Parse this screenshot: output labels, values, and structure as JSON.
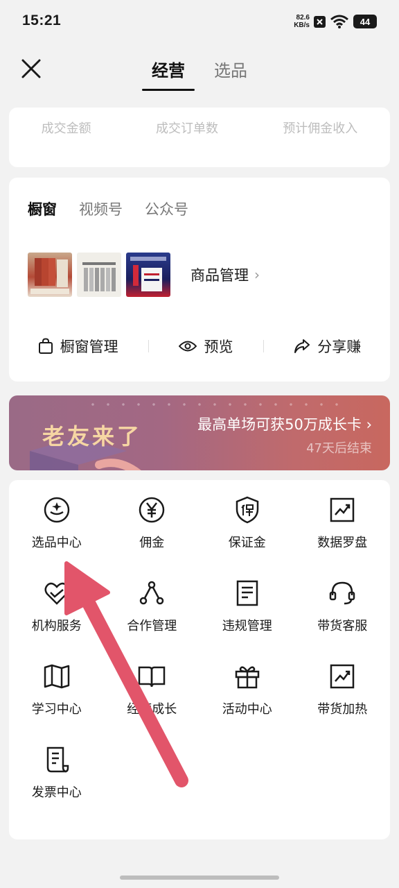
{
  "status": {
    "time": "15:21",
    "speed_value": "82.6",
    "speed_unit": "KB/s",
    "battery": "44"
  },
  "header": {
    "tabs": [
      "经营",
      "选品"
    ],
    "active_tab": "经营"
  },
  "stats": {
    "labels": [
      "成交金额",
      "成交订单数",
      "预计佣金收入"
    ]
  },
  "showcase": {
    "sub_tabs": [
      "橱窗",
      "视频号",
      "公众号"
    ],
    "manage_label": "商品管理",
    "actions": [
      "橱窗管理",
      "预览",
      "分享赚"
    ]
  },
  "banner": {
    "title": "老友来了",
    "main_text": "最高单场可获50万成长卡",
    "sub_text": "47天后结束"
  },
  "grid": [
    {
      "label": "选品中心",
      "icon": "select-center-icon"
    },
    {
      "label": "佣金",
      "icon": "yuan-icon"
    },
    {
      "label": "保证金",
      "icon": "deposit-shield-icon"
    },
    {
      "label": "数据罗盘",
      "icon": "chart-icon"
    },
    {
      "label": "机构服务",
      "icon": "heart-hand-icon"
    },
    {
      "label": "合作管理",
      "icon": "network-icon"
    },
    {
      "label": "违规管理",
      "icon": "document-icon"
    },
    {
      "label": "带货客服",
      "icon": "headset-icon"
    },
    {
      "label": "学习中心",
      "icon": "map-book-icon"
    },
    {
      "label": "经营成长",
      "icon": "open-book-icon"
    },
    {
      "label": "活动中心",
      "icon": "gift-icon"
    },
    {
      "label": "带货加热",
      "icon": "trend-icon"
    },
    {
      "label": "发票中心",
      "icon": "receipt-icon"
    }
  ],
  "colors": {
    "banner_title": "#f6d6a3",
    "arrow": "#e2556a"
  }
}
